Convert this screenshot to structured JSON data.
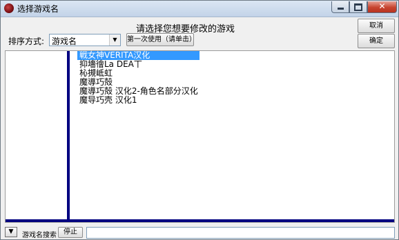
{
  "window": {
    "title": "选择游戏名",
    "close_glyph": "✕"
  },
  "header": {
    "prompt": "请选择您想要修改的游戏",
    "sort_label": "排序方式:",
    "sort_value": "游戏名",
    "first_use_label": "第一次使用（请单击）",
    "cancel_label": "取消",
    "ok_label": "确定"
  },
  "games": {
    "items": [
      {
        "label": "戦女神VERITA汉化",
        "selected": true
      },
      {
        "label": "抑墻徻La DEA丅",
        "selected": false
      },
      {
        "label": "杺摫岻虹",
        "selected": false
      },
      {
        "label": "魔導巧殻",
        "selected": false
      },
      {
        "label": "魔導巧殻 汉化2-角色名部分汉化",
        "selected": false
      },
      {
        "label": "魔导巧壳 汉化1",
        "selected": false
      }
    ]
  },
  "footer": {
    "search_label": "游戏名搜索",
    "stop_label": "停止",
    "search_value": ""
  },
  "colors": {
    "selection": "#3399ff",
    "splitter": "#000080"
  }
}
